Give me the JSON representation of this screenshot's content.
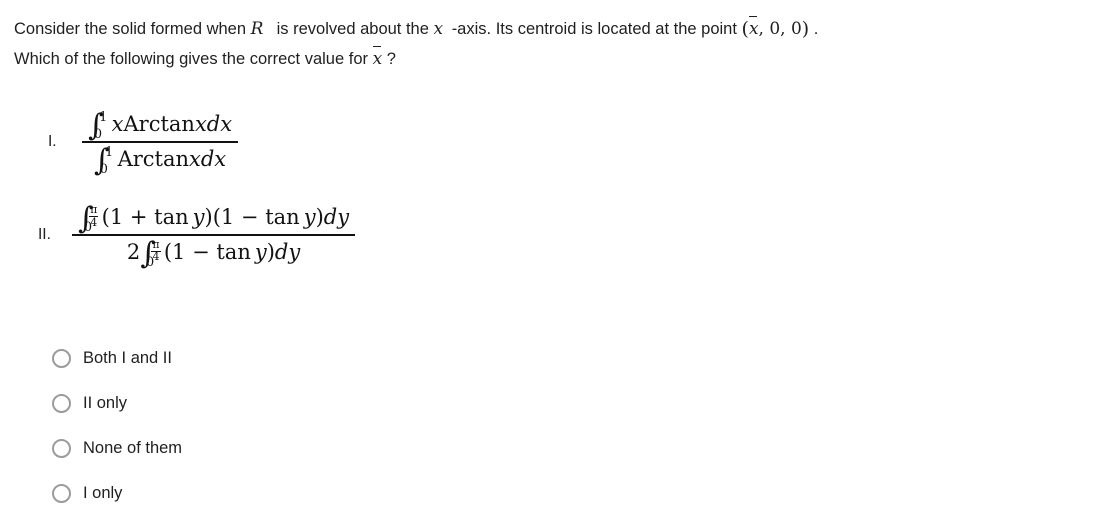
{
  "prompt": {
    "line1_part1": "Consider the solid formed when",
    "line1_symbol_R": "R",
    "line1_part2": "is revolved about the",
    "line1_symbol_x": "x",
    "line1_part3": "-axis. Its centroid is located at the point",
    "point_open": "(",
    "point_xbar": "x",
    "point_rest": ", 0, 0",
    "point_close": ")",
    "point_period": ".",
    "line2_part1": "Which of the following gives the correct value for",
    "line2_xbar": "x",
    "line2_part2": "?"
  },
  "formulas": [
    {
      "label": "I.",
      "numerator": {
        "integral": "∫",
        "lower": "0",
        "upper": "1",
        "body_italic_1": "x",
        "body_roman": "Arctan",
        "body_italic_2": "x",
        "body_differential": "dx"
      },
      "denominator": {
        "integral": "∫",
        "lower": "0",
        "upper": "1",
        "body_roman": "Arctan",
        "body_italic_2": "x",
        "body_differential": "dx"
      }
    },
    {
      "label": "II.",
      "numerator": {
        "integral": "∫",
        "lower": "0",
        "upper_num": "π",
        "upper_den": "4",
        "factor1": "(1 + tan",
        "var1": "y",
        "factor1_close": ")",
        "factor2_open": "(1 − tan",
        "var2": "y",
        "factor2_close": ")",
        "differential": "dy"
      },
      "denominator": {
        "coefficient": "2",
        "integral": "∫",
        "lower": "0",
        "upper_num": "π",
        "upper_den": "4",
        "factor_open": "(1 − tan",
        "var": "y",
        "factor_close": ")",
        "differential": "dy"
      }
    }
  ],
  "choices": [
    {
      "label": "Both I and II",
      "selected": false
    },
    {
      "label": "II only",
      "selected": false
    },
    {
      "label": "None of them",
      "selected": false
    },
    {
      "label": "I only",
      "selected": false
    }
  ],
  "colors": {
    "text": "#1f1f1f",
    "math": "#121212",
    "radio_border": "#9b9b9b",
    "background": "#ffffff"
  }
}
